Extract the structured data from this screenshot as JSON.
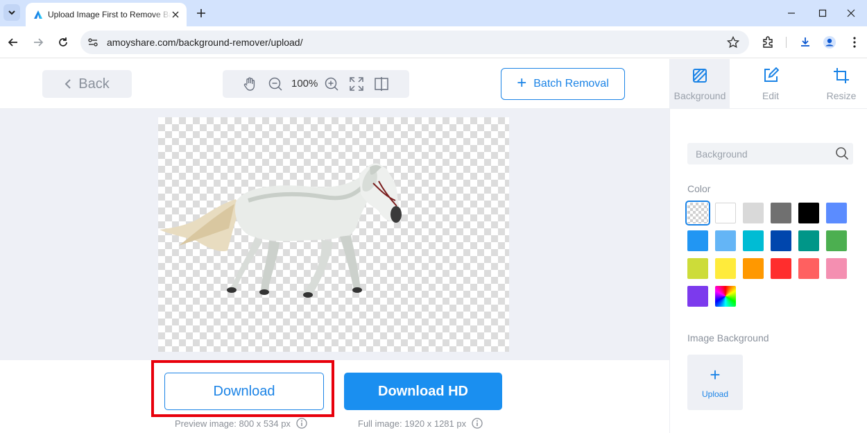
{
  "browser": {
    "tab_title": "Upload Image First to Remove Background",
    "url": "amoyshare.com/background-remover/upload/"
  },
  "header": {
    "back_label": "Back",
    "zoom": "100%",
    "batch_label": "Batch Removal"
  },
  "right_tabs": [
    {
      "label": "Background",
      "icon": "background-icon",
      "active": true
    },
    {
      "label": "Edit",
      "icon": "edit-icon",
      "active": false
    },
    {
      "label": "Resize",
      "icon": "crop-icon",
      "active": false
    }
  ],
  "actions": {
    "download_label": "Download",
    "download_hd_label": "Download HD",
    "preview_note": "Preview image: 800 x 534 px",
    "full_note": "Full image: 1920 x 1281 px"
  },
  "panel": {
    "search_placeholder": "Background",
    "color_label": "Color",
    "image_bg_label": "Image Background",
    "upload_label": "Upload",
    "colors": [
      "transparent",
      "#ffffff",
      "#d9d9d9",
      "#707070",
      "#000000",
      "#5b8cff",
      "#2196f3",
      "#64b5f6",
      "#00bcd4",
      "#0046ad",
      "#009688",
      "#4caf50",
      "#cddc39",
      "#ffeb3b",
      "#ff9800",
      "#ff2d2d",
      "#ff6060",
      "#f48fb1",
      "#7c3aed",
      "rainbow"
    ]
  },
  "colors": {
    "accent": "#1a83e6",
    "highlight": "#e8000b"
  }
}
